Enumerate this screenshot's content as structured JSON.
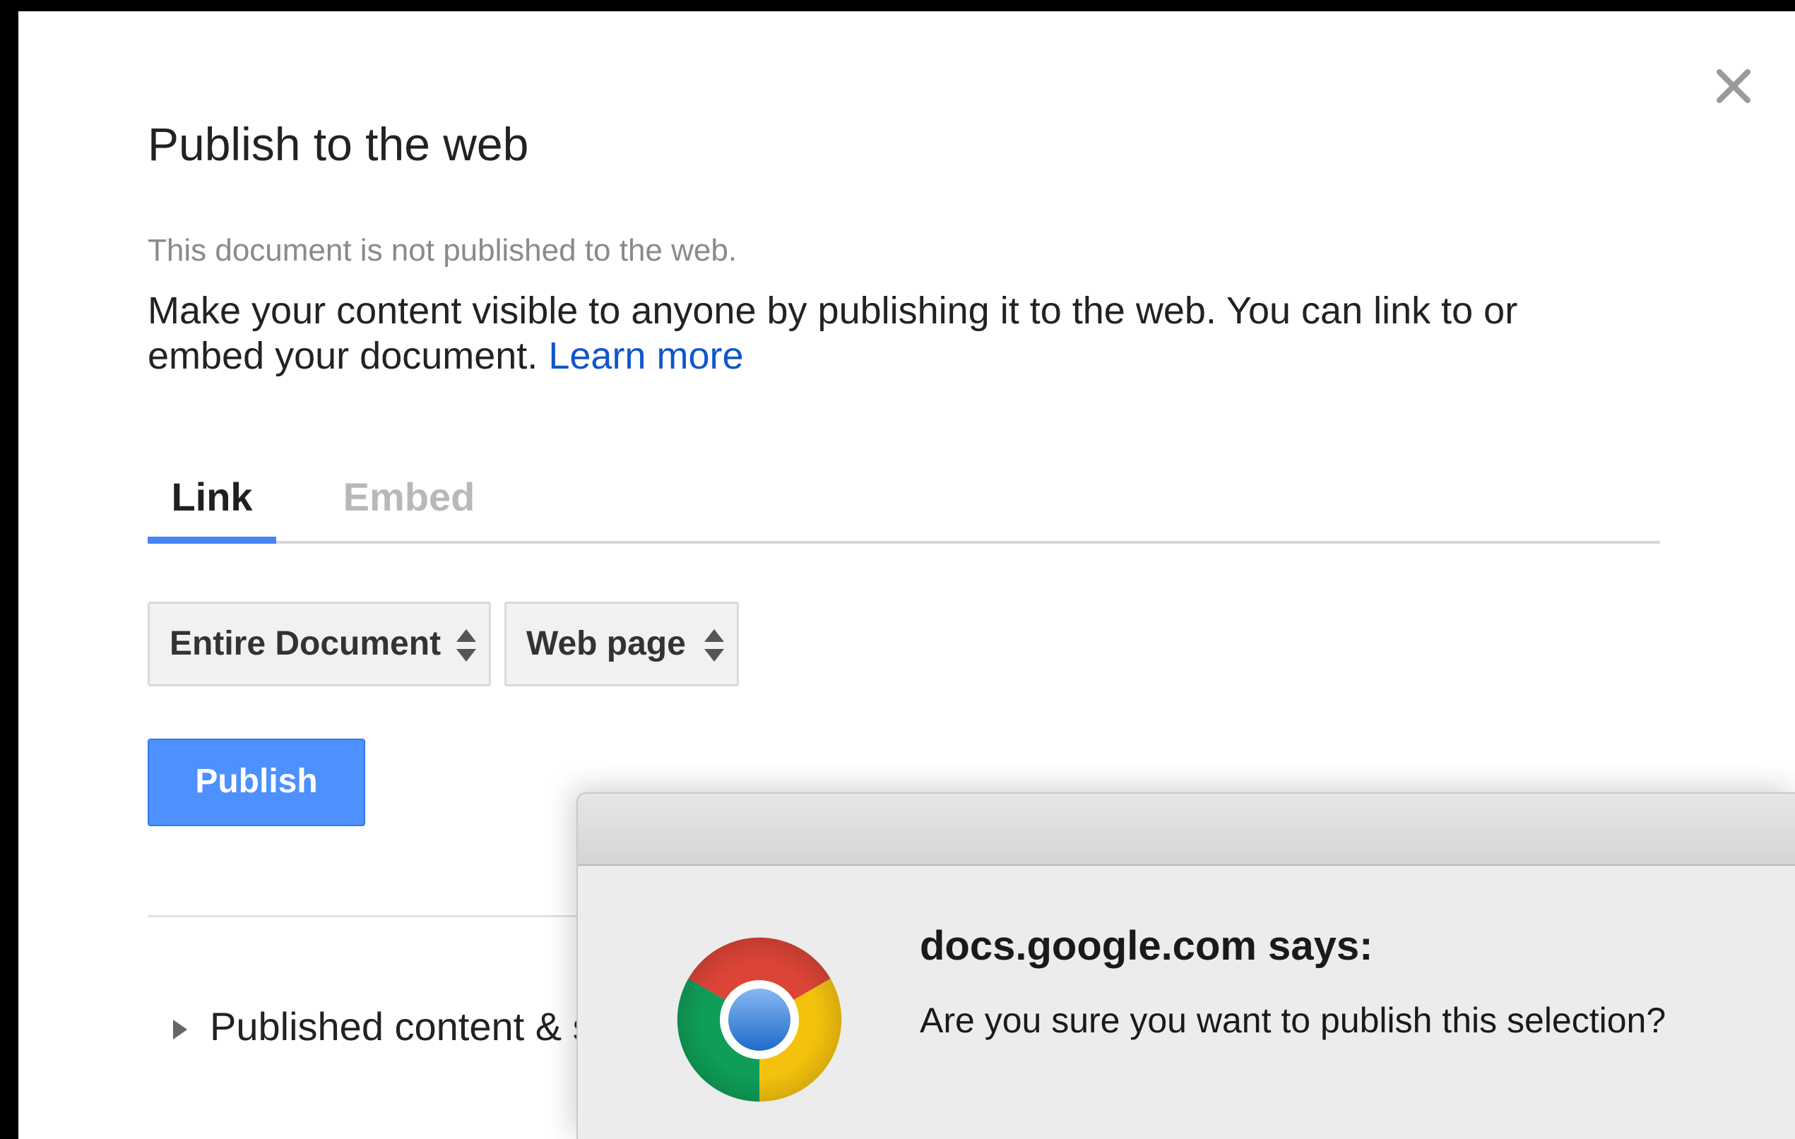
{
  "dialog": {
    "title": "Publish to the web",
    "status": "This document is not published to the web.",
    "description": "Make your content visible to anyone by publishing it to the web. You can link to or embed your document.",
    "learn_more": "Learn more",
    "tabs": [
      {
        "label": "Link",
        "active": true
      },
      {
        "label": "Embed",
        "active": false
      }
    ],
    "scope_select": {
      "selected": "Entire Document"
    },
    "format_select": {
      "selected": "Web page"
    },
    "publish_label": "Publish",
    "expander_label": "Published content & s",
    "close_icon": "close-icon"
  },
  "alert": {
    "title": "docs.google.com says:",
    "message": "Are you sure you want to publish this selection?",
    "icon": "chrome-logo-icon"
  },
  "colors": {
    "accent": "#4285f4",
    "publish_button": "#4d90fe",
    "link": "#1155cc"
  }
}
